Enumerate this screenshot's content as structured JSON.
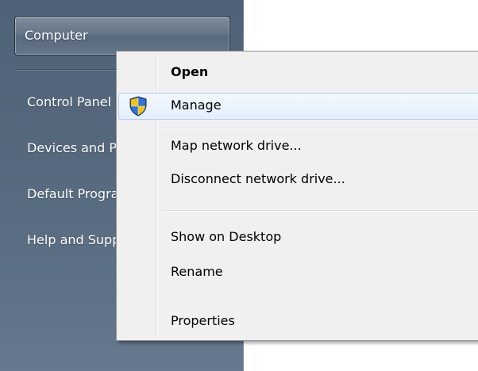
{
  "start_menu": {
    "items": [
      {
        "label": "Computer"
      },
      {
        "label": "Control Panel"
      },
      {
        "label": "Devices and Printers"
      },
      {
        "label": "Default Programs"
      },
      {
        "label": "Help and Support"
      }
    ]
  },
  "context_menu": {
    "items": [
      {
        "label": "Open",
        "bold": true
      },
      {
        "label": "Manage",
        "icon": "uac-shield-icon",
        "hovered": true
      },
      {
        "label": "Map network drive..."
      },
      {
        "label": "Disconnect network drive..."
      },
      {
        "label": "Show on Desktop"
      },
      {
        "label": "Rename"
      },
      {
        "label": "Properties"
      }
    ]
  },
  "colors": {
    "start_pane": "#55687c",
    "menu_background": "#f0f0f0",
    "hover_border": "#aecff7",
    "hover_fill": "#e3effd"
  }
}
